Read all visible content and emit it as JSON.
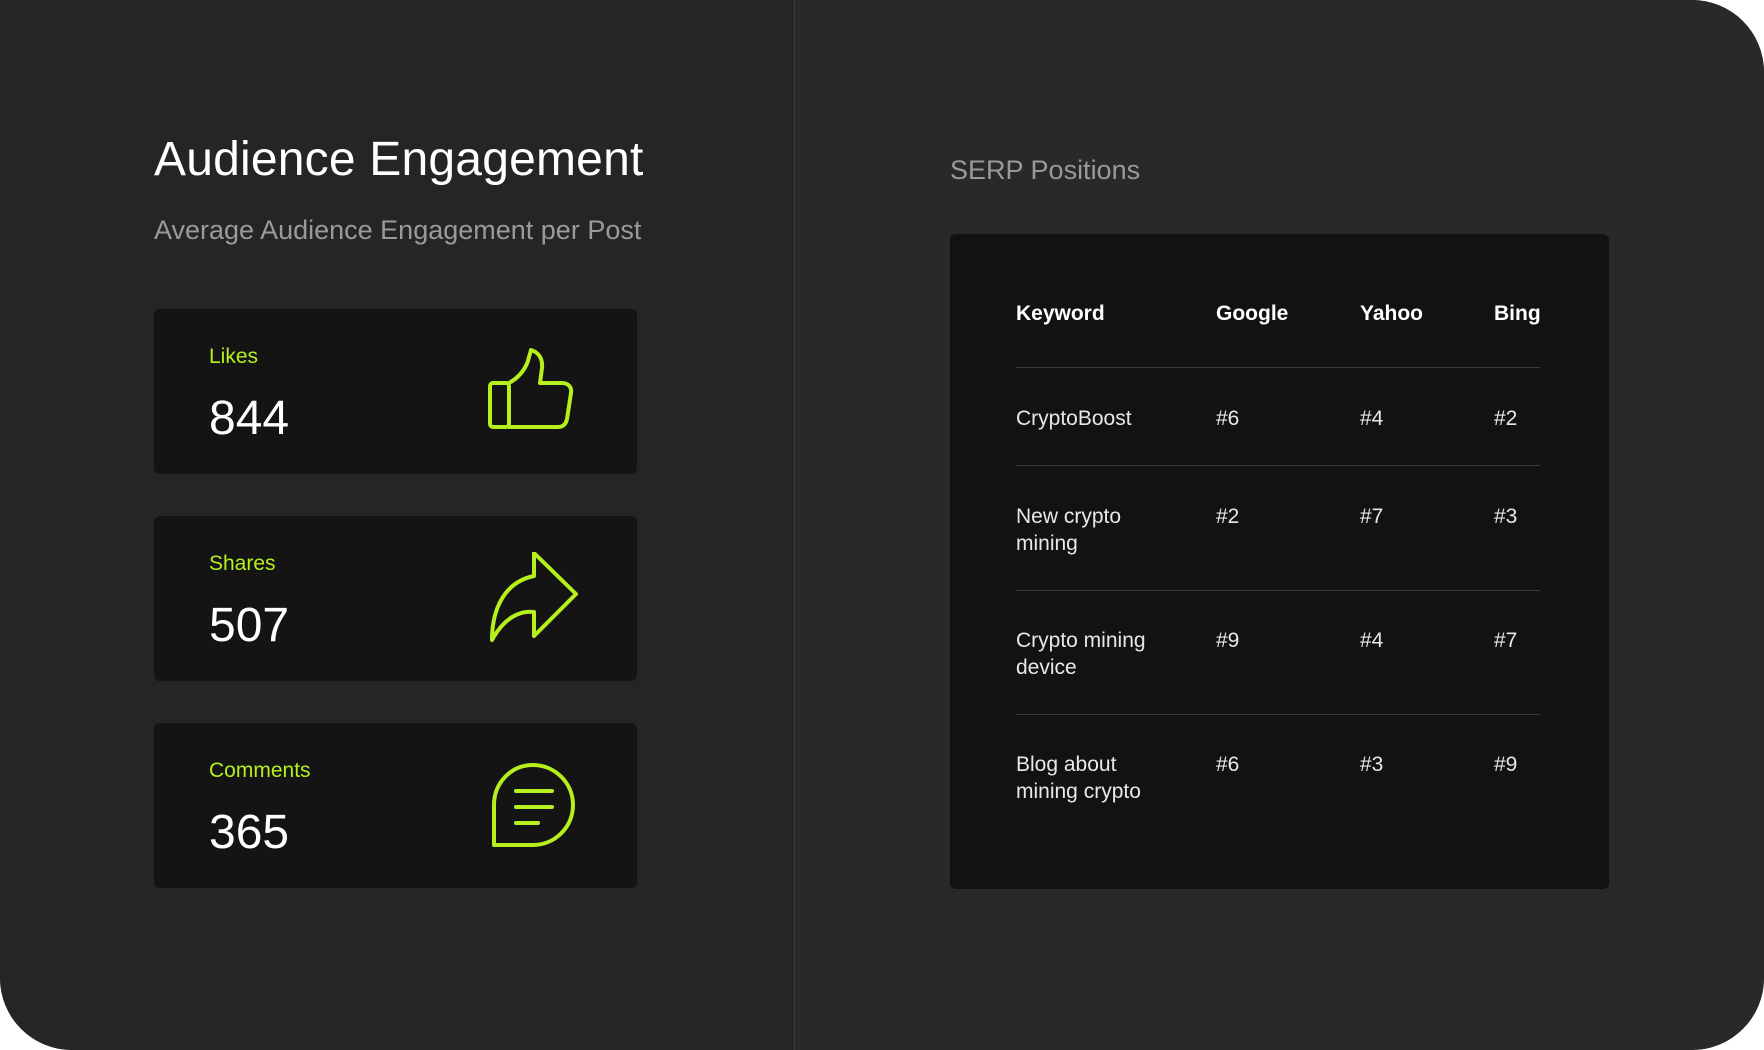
{
  "engagement": {
    "title": "Audience Engagement",
    "subtitle": "Average Audience Engagement per Post",
    "metrics": [
      {
        "label": "Likes",
        "value": "844",
        "icon": "thumbs-up-icon"
      },
      {
        "label": "Shares",
        "value": "507",
        "icon": "share-arrow-icon"
      },
      {
        "label": "Comments",
        "value": "365",
        "icon": "comment-bubble-icon"
      }
    ]
  },
  "serp": {
    "title": "SERP Positions",
    "headers": {
      "keyword": "Keyword",
      "google": "Google",
      "yahoo": "Yahoo",
      "bing": "Bing"
    },
    "rows": [
      {
        "keyword": "CryptoBoost",
        "google": "#6",
        "yahoo": "#4",
        "bing": "#2"
      },
      {
        "keyword": "New crypto\nmining",
        "google": "#2",
        "yahoo": "#7",
        "bing": "#3"
      },
      {
        "keyword": "Crypto mining\ndevice",
        "google": "#9",
        "yahoo": "#4",
        "bing": "#7"
      },
      {
        "keyword": "Blog about\nmining crypto",
        "google": "#6",
        "yahoo": "#3",
        "bing": "#9"
      }
    ]
  },
  "colors": {
    "accent": "#b6f01c",
    "background": "#262626",
    "card": "#141414"
  }
}
